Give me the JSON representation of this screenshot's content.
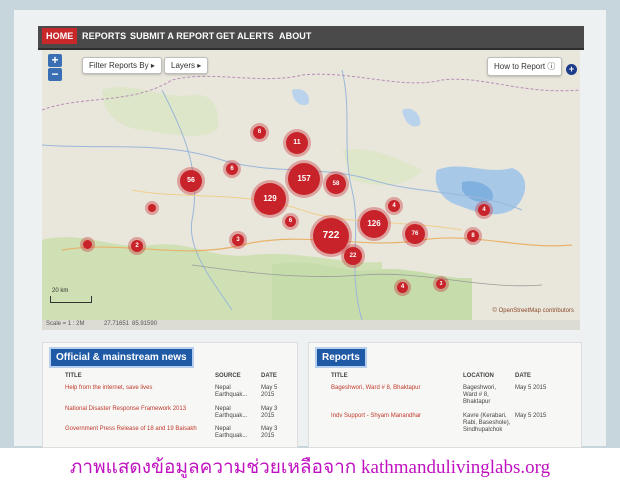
{
  "nav": {
    "home": "HOME",
    "reports": "REPORTS",
    "submit": "SUBMIT A REPORT",
    "alerts": "GET ALERTS",
    "about": "ABOUT"
  },
  "map": {
    "zoom_in": "+",
    "zoom_out": "−",
    "filter_label": "Filter Reports By",
    "layers_label": "Layers",
    "how_to_report": "How to Report",
    "scale": "Scale = 1 : 2M",
    "coords_lat": "27.71651",
    "coords_lon": "85.91590",
    "scale_bar_label": "20 km",
    "osm_credit": "© OpenStreetMap contributors",
    "clusters": [
      {
        "label": "6"
      },
      {
        "label": "11"
      },
      {
        "label": "157"
      },
      {
        "label": "58"
      },
      {
        "label": "56"
      },
      {
        "label": "6"
      },
      {
        "label": "129"
      },
      {
        "label": "6"
      },
      {
        "label": "722"
      },
      {
        "label": "126"
      },
      {
        "label": "76"
      },
      {
        "label": "22"
      },
      {
        "label": "2"
      },
      {
        "label": "3"
      },
      {
        "label": "4"
      },
      {
        "label": "8"
      },
      {
        "label": "4"
      },
      {
        "label": "3"
      },
      {
        "label": "4"
      },
      {
        "label": ""
      },
      {
        "label": ""
      },
      {
        "label": "6"
      }
    ]
  },
  "news": {
    "heading": "Official & mainstream news",
    "col_title": "TITLE",
    "col_source": "SOURCE",
    "col_date": "DATE",
    "rows": [
      {
        "title": "Help from the internet, save lives",
        "source": "Nepal Earthquak...",
        "date": "May 5 2015"
      },
      {
        "title": "National Disaster Response Framework 2013",
        "source": "Nepal Earthquak...",
        "date": "May 3 2015"
      },
      {
        "title": "Government Press Release of 18 and 19 Baisakh",
        "source": "Nepal Earthquak...",
        "date": "May 3 2015"
      }
    ]
  },
  "reports": {
    "heading": "Reports",
    "col_title": "TITLE",
    "col_location": "LOCATION",
    "col_date": "DATE",
    "rows": [
      {
        "title": "Bageshwori, Ward # 8, Bhaktapur",
        "location": "Bageshwori, Ward # 8, Bhaktapur",
        "date": "May 5 2015"
      },
      {
        "title": "Indv Support - Shyam Manandhar",
        "location": "Kavre (Kerabari, Rabi, Baseshole), Sindhupalchok",
        "date": "May 5 2015"
      }
    ]
  },
  "caption": "ภาพแสดงข้อมูลความช่วยเหลือจาก kathmandulivinglabs.org",
  "colors": {
    "accent": "#c8282a",
    "cluster": "#c8232a",
    "heading_blue": "#1f5aa6",
    "caption": "#c011c0"
  }
}
